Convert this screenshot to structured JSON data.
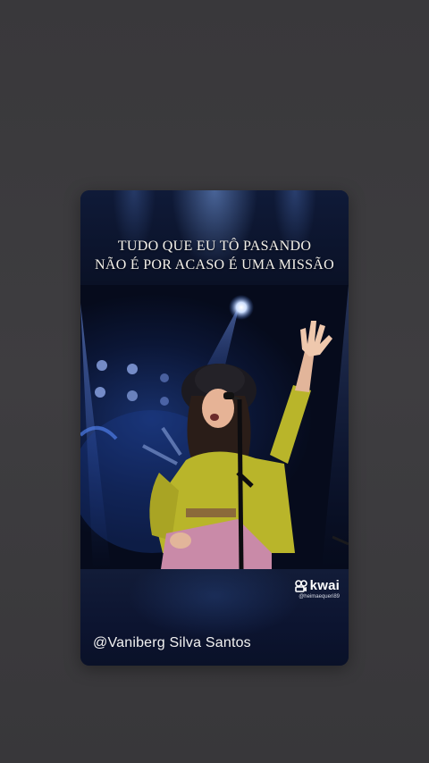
{
  "story": {
    "caption_line1": "TUDO QUE EU TÔ PASANDO",
    "caption_line2": "NÃO É POR ACASO É UMA MISSÃO",
    "author": "@Vaniberg Silva Santos"
  },
  "watermark": {
    "app_name": "kwai",
    "icon": "kwai-camera-icon",
    "username": "@heimaequeri89"
  },
  "colors": {
    "background": "#3b3a3d",
    "card": "#0a1227",
    "shirt": "#b9b52a",
    "pants": "#c98aa8"
  }
}
